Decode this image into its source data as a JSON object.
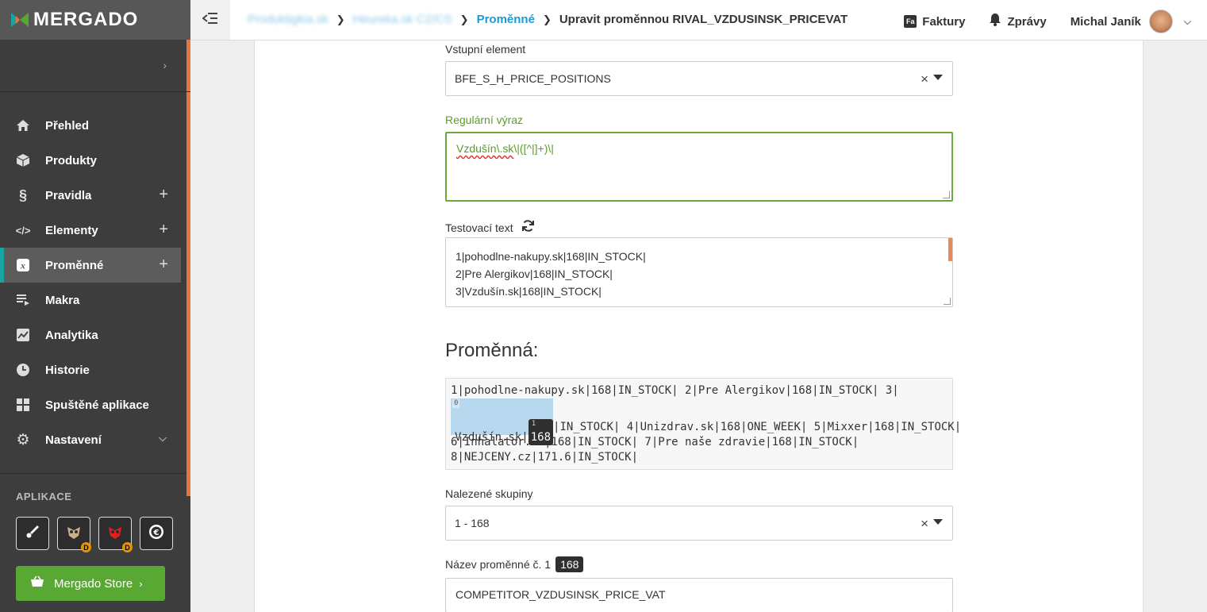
{
  "sidebar": {
    "logo": "MERGADO",
    "items": [
      {
        "label": "Přehled",
        "icon": "home-icon"
      },
      {
        "label": "Produkty",
        "icon": "box-icon"
      },
      {
        "label": "Pravidla",
        "icon": "section-icon",
        "plus": "+"
      },
      {
        "label": "Elementy",
        "icon": "code-icon",
        "plus": "+"
      },
      {
        "label": "Proměnné",
        "icon": "variable-icon",
        "plus": "+",
        "active": true
      },
      {
        "label": "Makra",
        "icon": "playlist-icon"
      },
      {
        "label": "Analytika",
        "icon": "chart-icon"
      },
      {
        "label": "Historie",
        "icon": "clock-icon"
      },
      {
        "label": "Spuštěné aplikace",
        "icon": "grid-icon"
      },
      {
        "label": "Nastavení",
        "icon": "gear-icon",
        "chevron": "⌄"
      }
    ],
    "apps_label": "APLIKACE",
    "app_badge": "D",
    "store_label": "Mergado Store"
  },
  "header": {
    "breadcrumb": {
      "blurred_1": "Produktigkia.sk",
      "blurred_2": "Heureka.sk CZ/CS",
      "link": "Proměnné",
      "current": "Upravit proměnnou RIVAL_VZDUSINSK_PRICEVAT"
    },
    "invoices": "Faktury",
    "invoices_icon": "Fa",
    "messages": "Zprávy",
    "user": "Michal Janík"
  },
  "form": {
    "input_element_label": "Vstupní element",
    "input_element_value": "BFE_S_H_PRICE_POSITIONS",
    "regex_label": "Regulární výraz",
    "regex_value_a": "Vzdušín\\.sk",
    "regex_value_b": "\\|([^|]+)\\|",
    "test_text_label": "Testovací text",
    "test_lines": [
      "1|pohodlne-nakupy.sk|168|IN_STOCK|",
      "2|Pre Alergikov|168|IN_STOCK|",
      "3|Vzdušín.sk|168|IN_STOCK|"
    ],
    "section_title": "Proměnná:",
    "result": {
      "line1": "1|pohodlne-nakupy.sk|168|IN_STOCK| 2|Pre Alergikov|168|IN_STOCK| 3|",
      "match_index": "0",
      "match_prefix": "Vzdušín.sk|",
      "group_index": "1",
      "group_value": "168",
      "after_match": "|IN_STOCK| 4|Unizdrav.sk|168|ONE_WEEK| 5|Mixxer|168|IN_STOCK|",
      "line3": "6|Inhalator.sk|168|IN_STOCK| 7|Pre naše zdravie|168|IN_STOCK|",
      "line4": "8|NEJCENY.cz|171.6|IN_STOCK|"
    },
    "groups_label": "Nalezené skupiny",
    "groups_value": "1 - 168",
    "var_name_label": "Název proměnné č. 1",
    "var_name_tag": "168",
    "var_name_value": "COMPETITOR_VZDUSINSK_PRICE_VAT"
  },
  "colors": {
    "sidebar_bg": "#3d3d3d",
    "accent_orange": "#e8763a",
    "accent_teal": "#1aa3a3",
    "link_blue": "#1a9ad6",
    "success_green": "#5aa834",
    "regex_green": "#5a9d2a",
    "match_blue": "#b7d7ee"
  }
}
